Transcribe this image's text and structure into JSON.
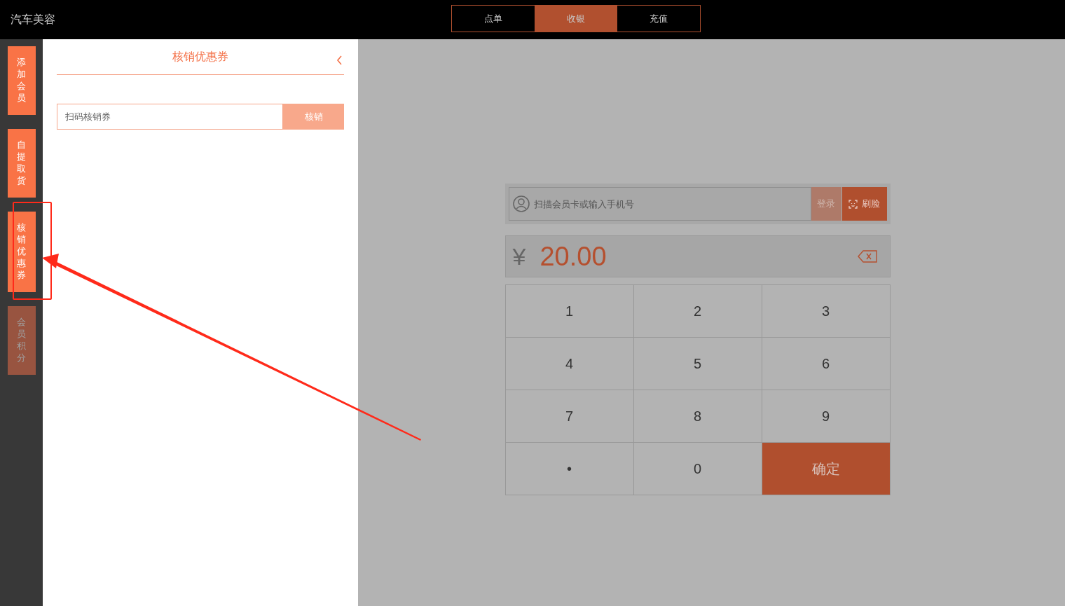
{
  "header": {
    "title": "汽车美容",
    "tabs": [
      {
        "label": "点单",
        "selected": false
      },
      {
        "label": "收银",
        "selected": true
      },
      {
        "label": "充值",
        "selected": false
      }
    ]
  },
  "sidebar": {
    "items": [
      {
        "label": "添加会员",
        "disabled": false
      },
      {
        "label": "自提取货",
        "disabled": false
      },
      {
        "label": "核销优惠券",
        "disabled": false
      },
      {
        "label": "会员积分",
        "disabled": true
      }
    ]
  },
  "panel": {
    "title": "核销优惠券",
    "coupon_field": {
      "placeholder": "扫码核销券"
    },
    "verify_button": "核销"
  },
  "cashier": {
    "member_field": {
      "placeholder": "扫描会员卡或输入手机号"
    },
    "login_button": "登录",
    "face_button": "刷脸",
    "currency": "¥",
    "amount": "20.00",
    "keys": [
      {
        "label": "1",
        "kind": "digit"
      },
      {
        "label": "2",
        "kind": "digit"
      },
      {
        "label": "3",
        "kind": "digit"
      },
      {
        "label": "4",
        "kind": "digit"
      },
      {
        "label": "5",
        "kind": "digit"
      },
      {
        "label": "6",
        "kind": "digit"
      },
      {
        "label": "7",
        "kind": "digit"
      },
      {
        "label": "8",
        "kind": "digit"
      },
      {
        "label": "9",
        "kind": "digit"
      },
      {
        "label": "•",
        "kind": "digit"
      },
      {
        "label": "0",
        "kind": "digit"
      },
      {
        "label": "确定",
        "kind": "confirm"
      }
    ]
  }
}
